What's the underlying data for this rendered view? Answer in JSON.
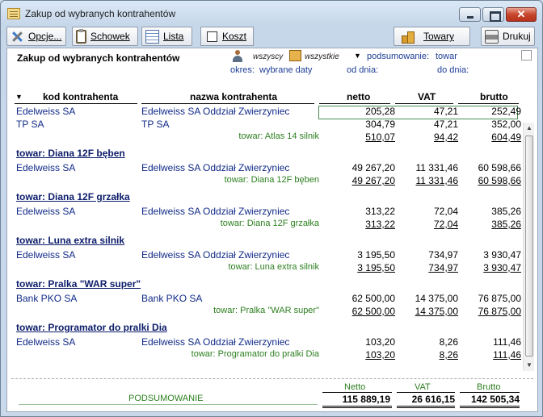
{
  "window": {
    "title": "Zakup od wybranych kontrahentów"
  },
  "toolbar": {
    "opcje": "Opcje...",
    "schowek": "Schowek",
    "lista": "Lista",
    "koszt": "Koszt",
    "towary": "Towary",
    "drukuj": "Drukuj"
  },
  "report": {
    "title": "Zakup od wybranych kontrahentów",
    "filter_contractors": "wszyscy",
    "filter_goods": "wszystkie",
    "summary_label": "podsumowanie:",
    "summary_value": "towar",
    "period_label": "okres:",
    "period_value": "wybrane daty",
    "from_label": "od dnia:",
    "to_label": "do dnia:"
  },
  "columns": {
    "kod": "kod kontrahenta",
    "nazwa": "nazwa kontrahenta",
    "netto": "netto",
    "vat": "VAT",
    "brutto": "brutto"
  },
  "rows": [
    {
      "type": "data",
      "kod": "Edelweiss SA",
      "nazwa": "Edelweiss SA Oddział Zwierzyniec",
      "netto": "205,28",
      "vat": "47,21",
      "brutto": "252,49"
    },
    {
      "type": "data",
      "kod": "TP SA",
      "nazwa": "TP SA",
      "netto": "304,79",
      "vat": "47,21",
      "brutto": "352,00"
    },
    {
      "type": "sum",
      "label": "towar: Atlas 14 silnik",
      "netto": "510,07",
      "vat": "94,42",
      "brutto": "604,49"
    },
    {
      "type": "group",
      "label": "towar: Diana 12F bęben"
    },
    {
      "type": "data",
      "kod": "Edelweiss SA",
      "nazwa": "Edelweiss SA Oddział Zwierzyniec",
      "netto": "49 267,20",
      "vat": "11 331,46",
      "brutto": "60 598,66"
    },
    {
      "type": "sum",
      "label": "towar: Diana 12F bęben",
      "netto": "49 267,20",
      "vat": "11 331,46",
      "brutto": "60 598,66"
    },
    {
      "type": "group",
      "label": "towar: Diana 12F grzałka"
    },
    {
      "type": "data",
      "kod": "Edelweiss SA",
      "nazwa": "Edelweiss SA Oddział Zwierzyniec",
      "netto": "313,22",
      "vat": "72,04",
      "brutto": "385,26"
    },
    {
      "type": "sum",
      "label": "towar: Diana 12F grzałka",
      "netto": "313,22",
      "vat": "72,04",
      "brutto": "385,26"
    },
    {
      "type": "group",
      "label": "towar: Luna extra silnik"
    },
    {
      "type": "data",
      "kod": "Edelweiss SA",
      "nazwa": "Edelweiss SA Oddział Zwierzyniec",
      "netto": "3 195,50",
      "vat": "734,97",
      "brutto": "3 930,47"
    },
    {
      "type": "sum",
      "label": "towar: Luna extra silnik",
      "netto": "3 195,50",
      "vat": "734,97",
      "brutto": "3 930,47"
    },
    {
      "type": "group",
      "label": "towar: Pralka \"WAR super\""
    },
    {
      "type": "data",
      "kod": "Bank PKO SA",
      "nazwa": "Bank PKO SA",
      "netto": "62 500,00",
      "vat": "14 375,00",
      "brutto": "76 875,00"
    },
    {
      "type": "sum",
      "label": "towar: Pralka \"WAR super\"",
      "netto": "62 500,00",
      "vat": "14 375,00",
      "brutto": "76 875,00"
    },
    {
      "type": "group",
      "label": "towar: Programator do pralki Dia"
    },
    {
      "type": "data",
      "kod": "Edelweiss SA",
      "nazwa": "Edelweiss SA Oddział Zwierzyniec",
      "netto": "103,20",
      "vat": "8,26",
      "brutto": "111,46"
    },
    {
      "type": "sum",
      "label": "towar: Programator do pralki Dia",
      "netto": "103,20",
      "vat": "8,26",
      "brutto": "111,46"
    }
  ],
  "footer": {
    "netto_label": "Netto",
    "vat_label": "VAT",
    "brutto_label": "Brutto",
    "summary_label": "PODSUMOWANIE",
    "netto": "115 889,19",
    "vat": "26 616,15",
    "brutto": "142 505,34"
  },
  "colors": {
    "accent_blue": "#112a88",
    "sum_green": "#2c7f1f"
  },
  "icons": {
    "opcje": "tools-icon",
    "schowek": "clipboard-icon",
    "lista": "list-icon",
    "towary": "goods-icon",
    "drukuj": "printer-icon"
  }
}
